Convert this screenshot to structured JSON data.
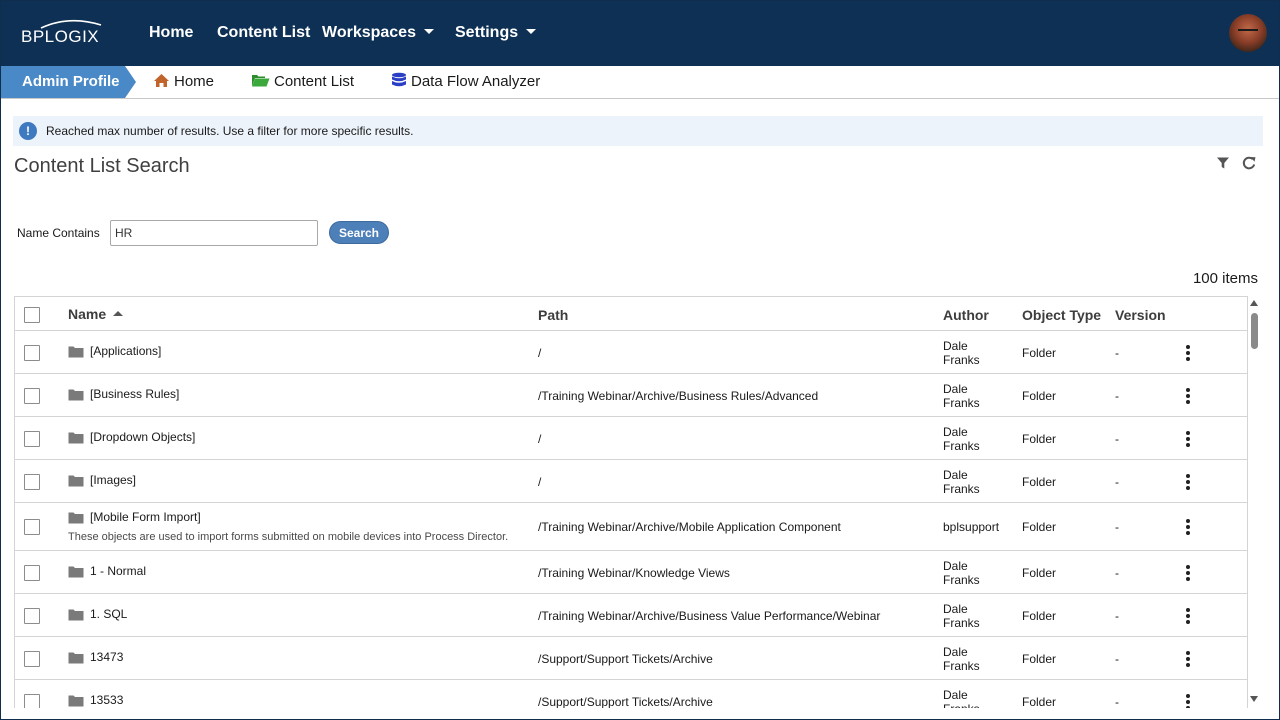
{
  "brand": {
    "logo_text": "BPLOGIX"
  },
  "topnav": {
    "items": [
      {
        "label": "Home"
      },
      {
        "label": "Content List"
      },
      {
        "label": "Workspaces"
      },
      {
        "label": "Settings"
      }
    ]
  },
  "breadcrumb": {
    "active": "Admin Profile",
    "items": [
      {
        "label": "Home",
        "icon": "home-icon"
      },
      {
        "label": "Content List",
        "icon": "open-folder-icon"
      },
      {
        "label": "Data Flow Analyzer",
        "icon": "database-icon"
      }
    ]
  },
  "banner": {
    "message": "Reached max number of results. Use a filter for more specific results."
  },
  "page": {
    "title": "Content List Search"
  },
  "search": {
    "label": "Name Contains",
    "value": "HR",
    "button": "Search"
  },
  "results": {
    "count_text": "100 items"
  },
  "grid": {
    "columns": [
      "Name",
      "Path",
      "Author",
      "Object Type",
      "Version"
    ],
    "rows": [
      {
        "name": "[Applications]",
        "path": "/",
        "author": "Dale Franks",
        "type": "Folder",
        "version": "-"
      },
      {
        "name": "[Business Rules]",
        "path": "/Training Webinar/Archive/Business Rules/Advanced",
        "author": "Dale Franks",
        "type": "Folder",
        "version": "-"
      },
      {
        "name": "[Dropdown Objects]",
        "path": "/",
        "author": "Dale Franks",
        "type": "Folder",
        "version": "-"
      },
      {
        "name": "[Images]",
        "path": "/",
        "author": "Dale Franks",
        "type": "Folder",
        "version": "-"
      },
      {
        "name": "[Mobile Form Import]",
        "description": "These objects are used to import forms submitted on mobile devices into Process Director.",
        "path": "/Training Webinar/Archive/Mobile Application Component",
        "author": "bplsupport",
        "type": "Folder",
        "version": "-"
      },
      {
        "name": "1 - Normal",
        "path": "/Training Webinar/Knowledge Views",
        "author": "Dale Franks",
        "type": "Folder",
        "version": "-"
      },
      {
        "name": "1. SQL",
        "path": "/Training Webinar/Archive/Business Value Performance/Webinar",
        "author": "Dale Franks",
        "type": "Folder",
        "version": "-"
      },
      {
        "name": "13473",
        "path": "/Support/Support Tickets/Archive",
        "author": "Dale Franks",
        "type": "Folder",
        "version": "-"
      },
      {
        "name": "13533",
        "path": "/Support/Support Tickets/Archive",
        "author": "Dale Franks",
        "type": "Folder",
        "version": "-"
      }
    ]
  },
  "colors": {
    "nav_bg": "#0d3054",
    "admin_tab": "#4a89c7",
    "banner_bg": "#edf3fb",
    "search_button": "#4d7fb8",
    "folder_icon": "#7a7a7a"
  }
}
